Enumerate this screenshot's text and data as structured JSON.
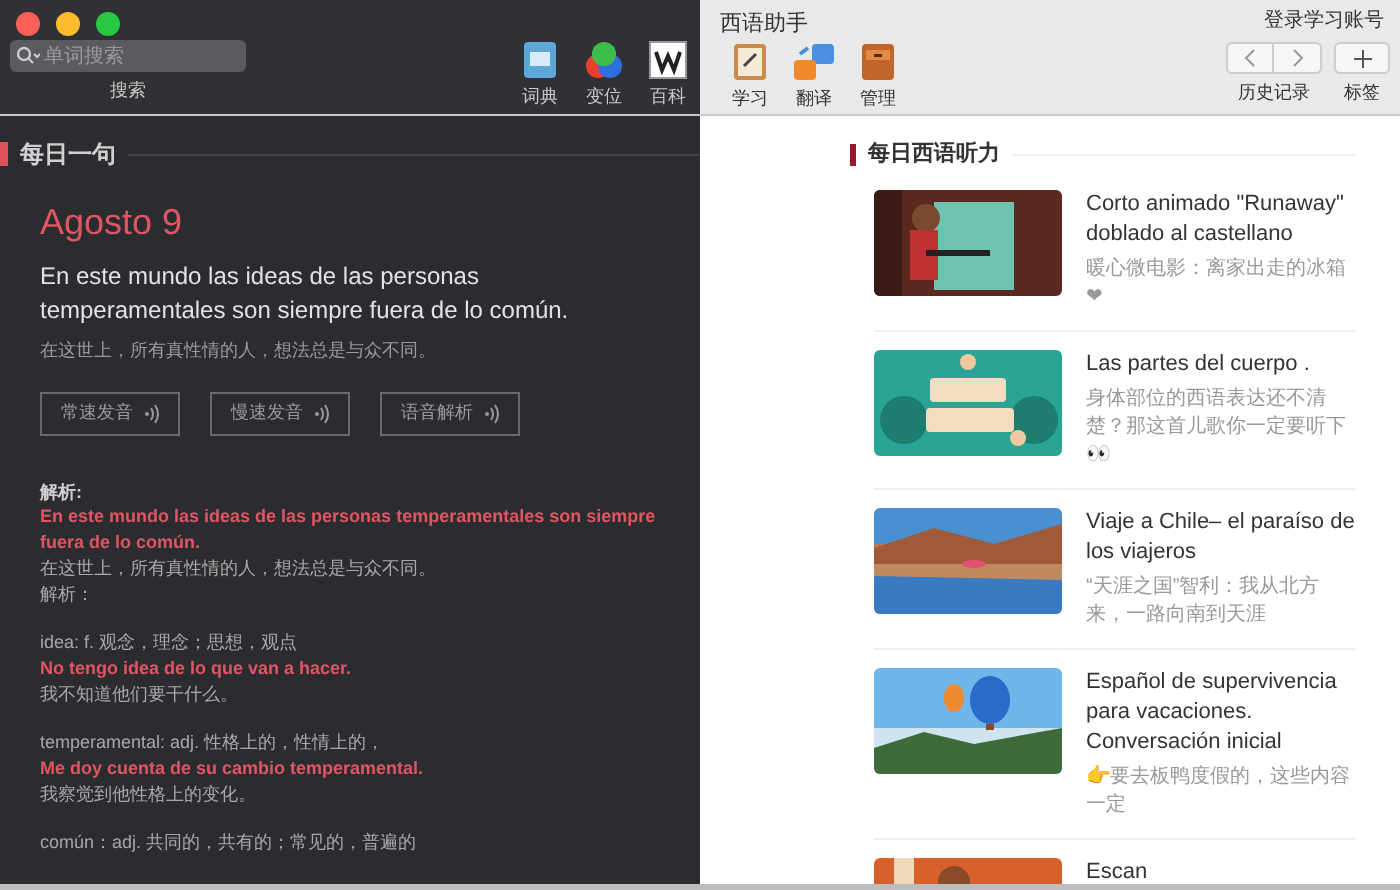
{
  "window": {
    "title": "西语助手",
    "account_link": "登录学习账号"
  },
  "toolbar": {
    "search": {
      "placeholder": "单词搜索",
      "label": "搜索"
    },
    "tools": [
      {
        "label": "词典",
        "kind": "dictionary",
        "dark": true
      },
      {
        "label": "变位",
        "kind": "conjugation",
        "dark": true
      },
      {
        "label": "百科",
        "kind": "wiki",
        "dark": true
      },
      {
        "label": "学习",
        "kind": "study",
        "dark": false
      },
      {
        "label": "翻译",
        "kind": "translate",
        "dark": false
      },
      {
        "label": "管理",
        "kind": "manage",
        "dark": false
      }
    ],
    "history": {
      "label": "历史记录"
    },
    "bookmark": {
      "label": "标签"
    }
  },
  "daily_sentence": {
    "heading": "每日一句",
    "date": "Agosto 9",
    "sentence": "En este mundo las ideas de las personas temperamentales son siempre fuera de lo común.",
    "translation": "在这世上，所有真性情的人，想法总是与众不同。",
    "audio_buttons": [
      "常速发音",
      "慢速发音",
      "语音解析"
    ],
    "analysis": {
      "heading": "解析:",
      "blocks": [
        [
          {
            "kind": "example",
            "text": "En este mundo las ideas de las personas temperamentales son siempre fuera de lo común."
          },
          {
            "kind": "note",
            "text": "在这世上，所有真性情的人，想法总是与众不同。"
          },
          {
            "kind": "note",
            "text": "解析："
          }
        ],
        [
          {
            "kind": "note",
            "text": "idea: f. 观念，理念；思想，观点"
          },
          {
            "kind": "example",
            "text": "No tengo idea de lo que van a hacer."
          },
          {
            "kind": "note",
            "text": "我不知道他们要干什么。"
          }
        ],
        [
          {
            "kind": "note",
            "text": "temperamental: adj. 性格上的，性情上的，"
          },
          {
            "kind": "example",
            "text": "Me doy cuenta de su cambio temperamental."
          },
          {
            "kind": "note",
            "text": "我察觉到他性格上的变化。"
          }
        ],
        [
          {
            "kind": "note",
            "text": "común：adj. 共同的，共有的；常见的，普遍的"
          }
        ]
      ]
    }
  },
  "listening": {
    "heading": "每日西语听力",
    "items": [
      {
        "title": "Corto animado \"Runaway\" doblado al castellano",
        "subtitle": "暖心微电影：离家出走的冰箱❤"
      },
      {
        "title": "Las partes del cuerpo .",
        "subtitle": "身体部位的西语表达还不清楚？那这首儿歌你一定要听下👀"
      },
      {
        "title": "Viaje a Chile– el paraíso de los viajeros",
        "subtitle": "“天涯之国”智利：我从北方来，一路向南到天涯"
      },
      {
        "title": "Español de supervivencia para vacaciones. Conversación inicial",
        "subtitle": "👉要去板鸭度假的，这些内容一定"
      },
      {
        "title": "Escan"
      }
    ]
  }
}
